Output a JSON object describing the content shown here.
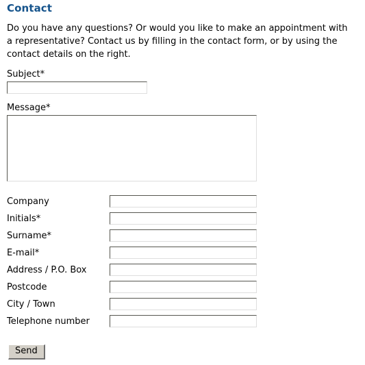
{
  "page": {
    "title": "Contact",
    "title_color": "#16548c",
    "background_color": "#ffffff",
    "intro": "Do you have any questions? Or would you like to make an appointment with a representative? Contact us by filling in the contact form, or by using the contact details on the right."
  },
  "form": {
    "subject": {
      "label": "Subject*",
      "value": "",
      "placeholder": ""
    },
    "message": {
      "label": "Message*",
      "value": "",
      "placeholder": ""
    },
    "rows": [
      {
        "label": "Company",
        "value": "",
        "placeholder": "",
        "required": false
      },
      {
        "label": "Initials*",
        "value": "",
        "placeholder": "",
        "required": true
      },
      {
        "label": "Surname*",
        "value": "",
        "placeholder": "",
        "required": true
      },
      {
        "label": "E-mail*",
        "value": "",
        "placeholder": "",
        "required": true
      },
      {
        "label": "Address / P.O. Box",
        "value": "",
        "placeholder": "",
        "required": false
      },
      {
        "label": "Postcode",
        "value": "",
        "placeholder": "",
        "required": false
      },
      {
        "label": "City / Town",
        "value": "",
        "placeholder": "",
        "required": false
      },
      {
        "label": "Telephone number",
        "value": "",
        "placeholder": "",
        "required": false
      }
    ],
    "submit": {
      "label": "Send",
      "face_color": "#d4d0c8"
    }
  }
}
